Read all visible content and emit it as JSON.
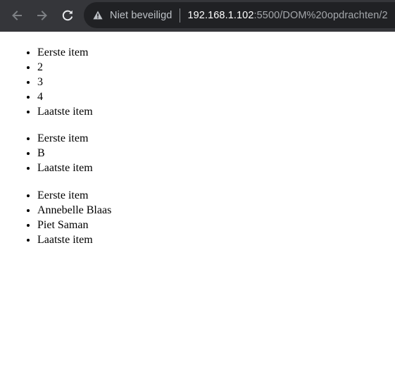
{
  "browser": {
    "security_label": "Niet beveiligd",
    "url_host": "192.168.1.102",
    "url_path": ":5500/DOM%20opdrachten/2",
    "toolbar_color": "#35363a",
    "omnibox_color": "#202124",
    "icons": {
      "back": "arrow-left-icon",
      "forward": "arrow-right-icon",
      "reload": "reload-icon",
      "security": "warning-triangle-icon"
    }
  },
  "lists": [
    {
      "items": [
        "Eerste item",
        "2",
        "3",
        "4",
        "Laatste item"
      ]
    },
    {
      "items": [
        "Eerste item",
        "B",
        "Laatste item"
      ]
    },
    {
      "items": [
        "Eerste item",
        "Annebelle Blaas",
        "Piet Saman",
        "Laatste item"
      ]
    }
  ]
}
